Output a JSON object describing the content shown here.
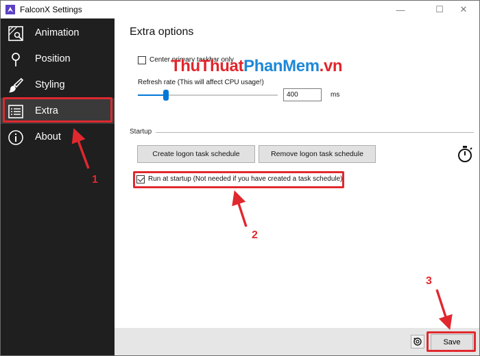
{
  "window": {
    "title": "FalconX Settings",
    "controls": {
      "minimize": "—",
      "maximize": "☐",
      "close": "✕"
    }
  },
  "sidebar": {
    "items": [
      {
        "label": "Animation",
        "icon": "animation-icon",
        "active": false
      },
      {
        "label": "Position",
        "icon": "position-pin-icon",
        "active": false
      },
      {
        "label": "Styling",
        "icon": "paintbrush-icon",
        "active": false
      },
      {
        "label": "Extra",
        "icon": "extra-grid-icon",
        "active": true
      },
      {
        "label": "About",
        "icon": "info-icon",
        "active": false
      }
    ]
  },
  "main": {
    "title": "Extra options",
    "center_taskbar": {
      "label": "Center primary taskbar only",
      "checked": false
    },
    "refresh_rate": {
      "label": "Refresh rate (This will affect CPU usage!)",
      "value": "400",
      "unit": "ms",
      "slider_fraction": 0.2
    },
    "startup": {
      "section_label": "Startup",
      "create_button": "Create logon task schedule",
      "remove_button": "Remove logon task schedule",
      "run_at_startup": {
        "label": "Run at startup (Not needed if you have created a task schedule)",
        "checked": true
      },
      "timer_icon": "stopwatch-icon"
    }
  },
  "footer": {
    "restore_icon": "restore-icon",
    "save_label": "Save"
  },
  "watermark": {
    "part1": "ThuThuat",
    "part2": "PhanMem",
    "part3": ".vn"
  },
  "annotations": {
    "one": "1",
    "two": "2",
    "three": "3"
  },
  "colors": {
    "sidebar_bg": "#1f1f1f",
    "sidebar_active": "#3a3a3a",
    "accent": "#0078d7",
    "annotation_red": "#e0282e"
  }
}
